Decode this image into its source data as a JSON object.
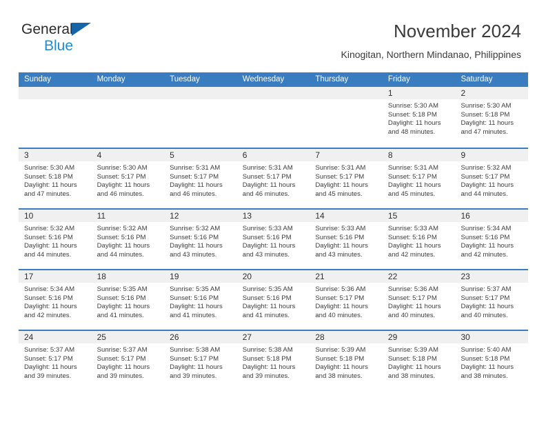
{
  "brand": {
    "name_part1": "General",
    "name_part2": "Blue",
    "mark": "triangle-logo"
  },
  "header": {
    "title": "November 2024",
    "subtitle": "Kinogitan, Northern Mindanao, Philippines"
  },
  "weekdays": [
    "Sunday",
    "Monday",
    "Tuesday",
    "Wednesday",
    "Thursday",
    "Friday",
    "Saturday"
  ],
  "colors": {
    "header_blue": "#3a7cc0",
    "brand_blue": "#1e8bd6",
    "logo_blue": "#1565a8",
    "day_band_gray": "#f0f0f0",
    "text_dark": "#3a3a3a"
  },
  "weeks": [
    [
      {
        "day": "",
        "lines": []
      },
      {
        "day": "",
        "lines": []
      },
      {
        "day": "",
        "lines": []
      },
      {
        "day": "",
        "lines": []
      },
      {
        "day": "",
        "lines": []
      },
      {
        "day": "1",
        "lines": [
          "Sunrise: 5:30 AM",
          "Sunset: 5:18 PM",
          "Daylight: 11 hours",
          "and 48 minutes."
        ]
      },
      {
        "day": "2",
        "lines": [
          "Sunrise: 5:30 AM",
          "Sunset: 5:18 PM",
          "Daylight: 11 hours",
          "and 47 minutes."
        ]
      }
    ],
    [
      {
        "day": "3",
        "lines": [
          "Sunrise: 5:30 AM",
          "Sunset: 5:18 PM",
          "Daylight: 11 hours",
          "and 47 minutes."
        ]
      },
      {
        "day": "4",
        "lines": [
          "Sunrise: 5:30 AM",
          "Sunset: 5:17 PM",
          "Daylight: 11 hours",
          "and 46 minutes."
        ]
      },
      {
        "day": "5",
        "lines": [
          "Sunrise: 5:31 AM",
          "Sunset: 5:17 PM",
          "Daylight: 11 hours",
          "and 46 minutes."
        ]
      },
      {
        "day": "6",
        "lines": [
          "Sunrise: 5:31 AM",
          "Sunset: 5:17 PM",
          "Daylight: 11 hours",
          "and 46 minutes."
        ]
      },
      {
        "day": "7",
        "lines": [
          "Sunrise: 5:31 AM",
          "Sunset: 5:17 PM",
          "Daylight: 11 hours",
          "and 45 minutes."
        ]
      },
      {
        "day": "8",
        "lines": [
          "Sunrise: 5:31 AM",
          "Sunset: 5:17 PM",
          "Daylight: 11 hours",
          "and 45 minutes."
        ]
      },
      {
        "day": "9",
        "lines": [
          "Sunrise: 5:32 AM",
          "Sunset: 5:17 PM",
          "Daylight: 11 hours",
          "and 44 minutes."
        ]
      }
    ],
    [
      {
        "day": "10",
        "lines": [
          "Sunrise: 5:32 AM",
          "Sunset: 5:16 PM",
          "Daylight: 11 hours",
          "and 44 minutes."
        ]
      },
      {
        "day": "11",
        "lines": [
          "Sunrise: 5:32 AM",
          "Sunset: 5:16 PM",
          "Daylight: 11 hours",
          "and 44 minutes."
        ]
      },
      {
        "day": "12",
        "lines": [
          "Sunrise: 5:32 AM",
          "Sunset: 5:16 PM",
          "Daylight: 11 hours",
          "and 43 minutes."
        ]
      },
      {
        "day": "13",
        "lines": [
          "Sunrise: 5:33 AM",
          "Sunset: 5:16 PM",
          "Daylight: 11 hours",
          "and 43 minutes."
        ]
      },
      {
        "day": "14",
        "lines": [
          "Sunrise: 5:33 AM",
          "Sunset: 5:16 PM",
          "Daylight: 11 hours",
          "and 43 minutes."
        ]
      },
      {
        "day": "15",
        "lines": [
          "Sunrise: 5:33 AM",
          "Sunset: 5:16 PM",
          "Daylight: 11 hours",
          "and 42 minutes."
        ]
      },
      {
        "day": "16",
        "lines": [
          "Sunrise: 5:34 AM",
          "Sunset: 5:16 PM",
          "Daylight: 11 hours",
          "and 42 minutes."
        ]
      }
    ],
    [
      {
        "day": "17",
        "lines": [
          "Sunrise: 5:34 AM",
          "Sunset: 5:16 PM",
          "Daylight: 11 hours",
          "and 42 minutes."
        ]
      },
      {
        "day": "18",
        "lines": [
          "Sunrise: 5:35 AM",
          "Sunset: 5:16 PM",
          "Daylight: 11 hours",
          "and 41 minutes."
        ]
      },
      {
        "day": "19",
        "lines": [
          "Sunrise: 5:35 AM",
          "Sunset: 5:16 PM",
          "Daylight: 11 hours",
          "and 41 minutes."
        ]
      },
      {
        "day": "20",
        "lines": [
          "Sunrise: 5:35 AM",
          "Sunset: 5:16 PM",
          "Daylight: 11 hours",
          "and 41 minutes."
        ]
      },
      {
        "day": "21",
        "lines": [
          "Sunrise: 5:36 AM",
          "Sunset: 5:17 PM",
          "Daylight: 11 hours",
          "and 40 minutes."
        ]
      },
      {
        "day": "22",
        "lines": [
          "Sunrise: 5:36 AM",
          "Sunset: 5:17 PM",
          "Daylight: 11 hours",
          "and 40 minutes."
        ]
      },
      {
        "day": "23",
        "lines": [
          "Sunrise: 5:37 AM",
          "Sunset: 5:17 PM",
          "Daylight: 11 hours",
          "and 40 minutes."
        ]
      }
    ],
    [
      {
        "day": "24",
        "lines": [
          "Sunrise: 5:37 AM",
          "Sunset: 5:17 PM",
          "Daylight: 11 hours",
          "and 39 minutes."
        ]
      },
      {
        "day": "25",
        "lines": [
          "Sunrise: 5:37 AM",
          "Sunset: 5:17 PM",
          "Daylight: 11 hours",
          "and 39 minutes."
        ]
      },
      {
        "day": "26",
        "lines": [
          "Sunrise: 5:38 AM",
          "Sunset: 5:17 PM",
          "Daylight: 11 hours",
          "and 39 minutes."
        ]
      },
      {
        "day": "27",
        "lines": [
          "Sunrise: 5:38 AM",
          "Sunset: 5:18 PM",
          "Daylight: 11 hours",
          "and 39 minutes."
        ]
      },
      {
        "day": "28",
        "lines": [
          "Sunrise: 5:39 AM",
          "Sunset: 5:18 PM",
          "Daylight: 11 hours",
          "and 38 minutes."
        ]
      },
      {
        "day": "29",
        "lines": [
          "Sunrise: 5:39 AM",
          "Sunset: 5:18 PM",
          "Daylight: 11 hours",
          "and 38 minutes."
        ]
      },
      {
        "day": "30",
        "lines": [
          "Sunrise: 5:40 AM",
          "Sunset: 5:18 PM",
          "Daylight: 11 hours",
          "and 38 minutes."
        ]
      }
    ]
  ]
}
